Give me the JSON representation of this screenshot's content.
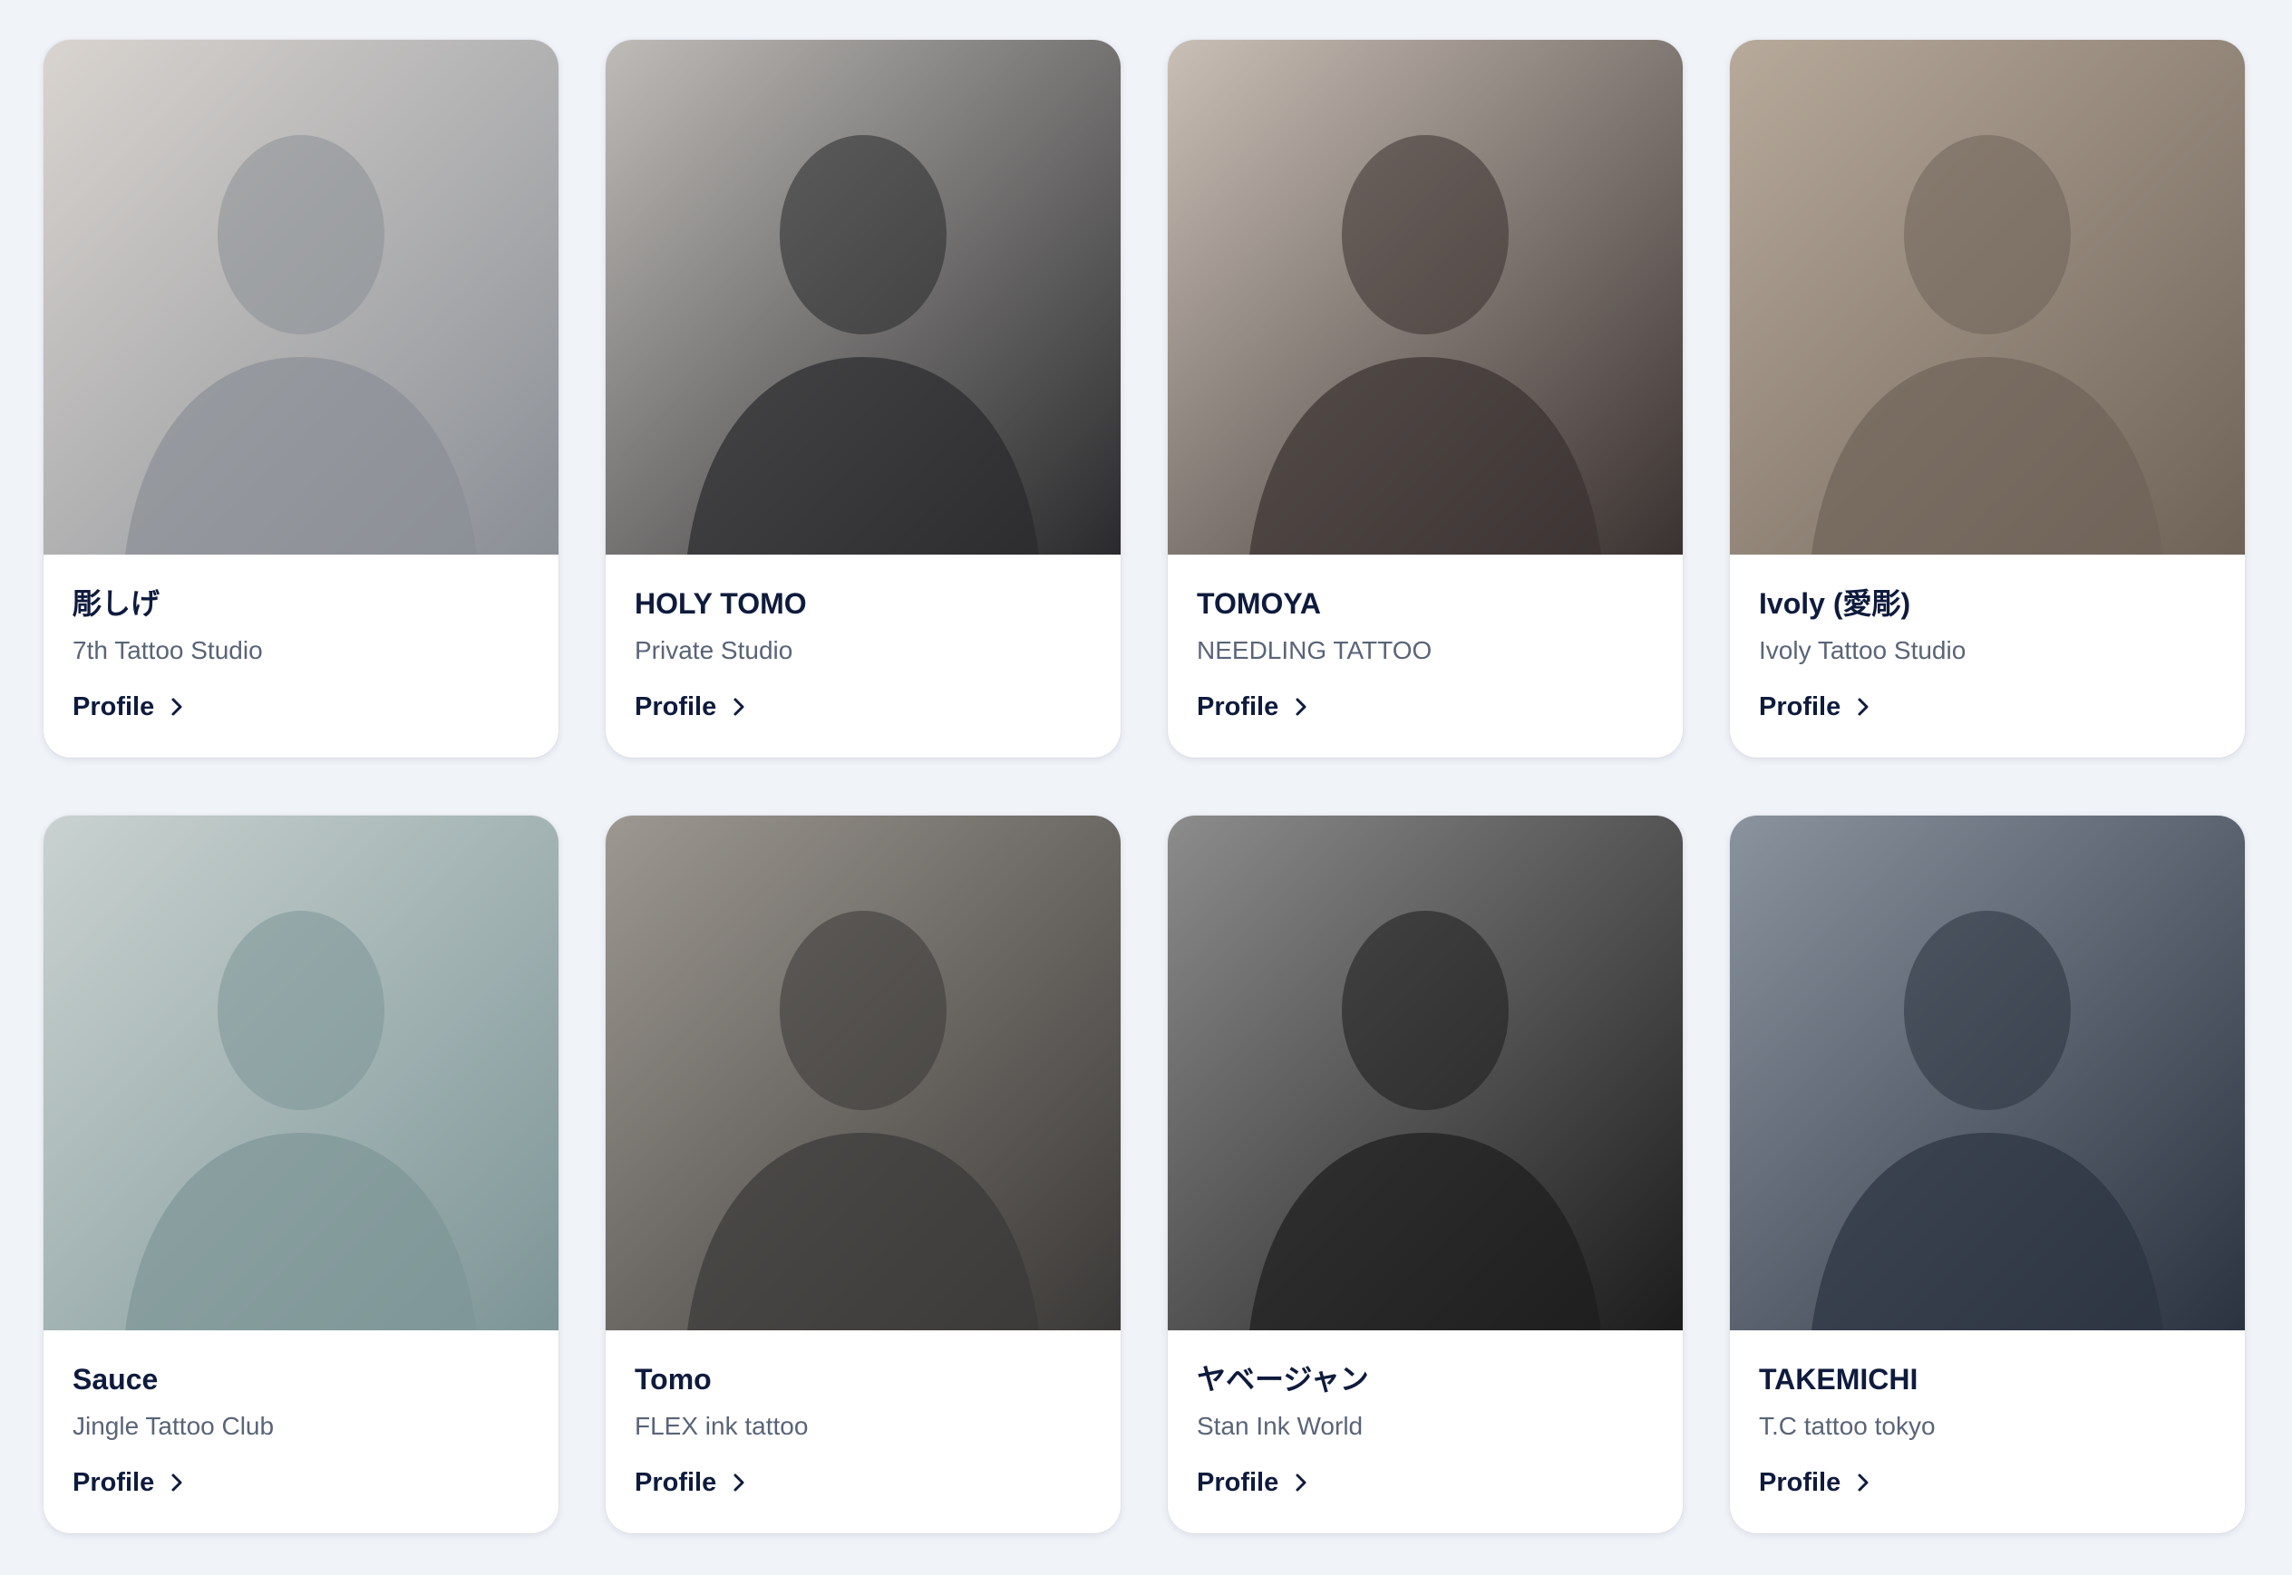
{
  "artists": [
    {
      "name": "彫しげ",
      "studio": "7th Tattoo Studio",
      "link_label": "Profile",
      "photo_tone": [
        "#8a8f96",
        "#d9d4cf"
      ],
      "photo_icon": "person-photo"
    },
    {
      "name": "HOLY TOMO",
      "studio": "Private Studio",
      "link_label": "Profile",
      "photo_tone": [
        "#2a2a2c",
        "#bfbcb8"
      ],
      "photo_icon": "person-photo"
    },
    {
      "name": "TOMOYA",
      "studio": "NEEDLING TATTOO",
      "link_label": "Profile",
      "photo_tone": [
        "#3a3230",
        "#c9bfb6"
      ],
      "photo_icon": "person-photo"
    },
    {
      "name": "Ivoly (愛彫)",
      "studio": "Ivoly Tattoo Studio",
      "link_label": "Profile",
      "photo_tone": [
        "#6f6358",
        "#b7aa9b"
      ],
      "photo_icon": "person-photo"
    },
    {
      "name": "Sauce",
      "studio": "Jingle Tattoo Club",
      "link_label": "Profile",
      "photo_tone": [
        "#7d9597",
        "#c9d2d0"
      ],
      "photo_icon": "person-photo"
    },
    {
      "name": "Tomo",
      "studio": "FLEX ink tattoo",
      "link_label": "Profile",
      "photo_tone": [
        "#3b3937",
        "#9d9891"
      ],
      "photo_icon": "person-photo"
    },
    {
      "name": "ヤベージャン",
      "studio": "Stan Ink World",
      "link_label": "Profile",
      "photo_tone": [
        "#1c1c1c",
        "#8c8c8c"
      ],
      "photo_icon": "person-photo"
    },
    {
      "name": "TAKEMICHI",
      "studio": "T.C tattoo tokyo",
      "link_label": "Profile",
      "photo_tone": [
        "#2b3340",
        "#8a939e"
      ],
      "photo_icon": "person-photo"
    }
  ],
  "colors": {
    "background": "#f0f3f8",
    "card": "#ffffff",
    "name_text": "#0f1b3d",
    "studio_text": "#5a6478"
  }
}
